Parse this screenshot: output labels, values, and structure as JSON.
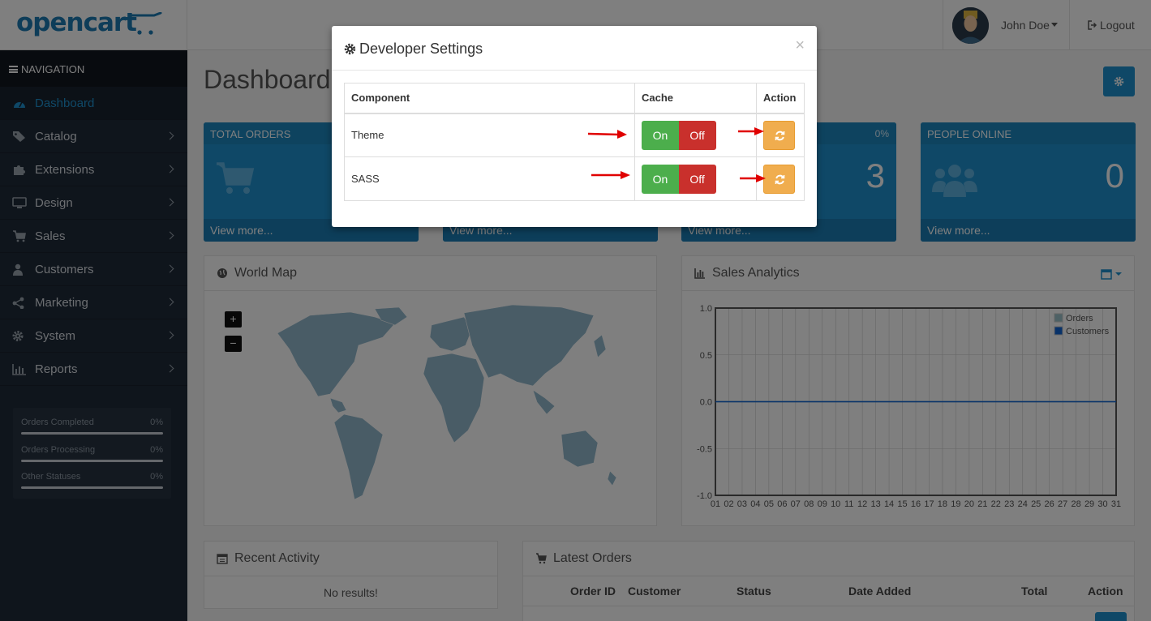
{
  "header": {
    "logo_text": "opencart",
    "user_name": "John Doe",
    "logout_label": "Logout"
  },
  "sidebar": {
    "nav_header": "NAVIGATION",
    "items": [
      {
        "label": "Dashboard",
        "icon": "dashboard-icon",
        "active": true
      },
      {
        "label": "Catalog",
        "icon": "tag-icon"
      },
      {
        "label": "Extensions",
        "icon": "puzzle-icon"
      },
      {
        "label": "Design",
        "icon": "monitor-icon"
      },
      {
        "label": "Sales",
        "icon": "cart-icon"
      },
      {
        "label": "Customers",
        "icon": "user-icon"
      },
      {
        "label": "Marketing",
        "icon": "share-icon"
      },
      {
        "label": "System",
        "icon": "gear-icon"
      },
      {
        "label": "Reports",
        "icon": "bar-chart-icon"
      }
    ],
    "progress": [
      {
        "label": "Orders Completed",
        "value": "0%"
      },
      {
        "label": "Orders Processing",
        "value": "0%"
      },
      {
        "label": "Other Statuses",
        "value": "0%"
      }
    ]
  },
  "main": {
    "title": "Dashboard",
    "tiles": [
      {
        "title": "TOTAL ORDERS",
        "pct": "",
        "value": "",
        "more": "View more..."
      },
      {
        "title": "",
        "pct": "",
        "value": "",
        "more": "View more..."
      },
      {
        "title": "",
        "pct": "0%",
        "value": "3",
        "more": "View more..."
      },
      {
        "title": "PEOPLE ONLINE",
        "pct": "",
        "value": "0",
        "more": "View more..."
      }
    ],
    "world_map": {
      "title": "World Map",
      "zoom_in": "+",
      "zoom_out": "−"
    },
    "sales_analytics": {
      "title": "Sales Analytics"
    },
    "recent_activity": {
      "title": "Recent Activity",
      "empty": "No results!"
    },
    "latest_orders": {
      "title": "Latest Orders",
      "columns": [
        "Order ID",
        "Customer",
        "Status",
        "Date Added",
        "Total",
        "Action"
      ]
    }
  },
  "chart_data": {
    "type": "line",
    "x": [
      "01",
      "02",
      "03",
      "04",
      "05",
      "06",
      "07",
      "08",
      "09",
      "10",
      "11",
      "12",
      "13",
      "14",
      "15",
      "16",
      "17",
      "18",
      "19",
      "20",
      "21",
      "22",
      "23",
      "24",
      "25",
      "26",
      "27",
      "28",
      "29",
      "30",
      "31"
    ],
    "series": [
      {
        "name": "Orders",
        "values": [
          0,
          0,
          0,
          0,
          0,
          0,
          0,
          0,
          0,
          0,
          0,
          0,
          0,
          0,
          0,
          0,
          0,
          0,
          0,
          0,
          0,
          0,
          0,
          0,
          0,
          0,
          0,
          0,
          0,
          0,
          0
        ],
        "color": "#9cc2cb"
      },
      {
        "name": "Customers",
        "values": [
          0,
          0,
          0,
          0,
          0,
          0,
          0,
          0,
          0,
          0,
          0,
          0,
          0,
          0,
          0,
          0,
          0,
          0,
          0,
          0,
          0,
          0,
          0,
          0,
          0,
          0,
          0,
          0,
          0,
          0,
          0
        ],
        "color": "#1065d2"
      }
    ],
    "yticks": [
      "1.0",
      "0.5",
      "0.0",
      "-0.5",
      "-1.0"
    ],
    "ylim": [
      -1,
      1
    ],
    "grid": true,
    "legend": "top-right"
  },
  "modal": {
    "title": "Developer Settings",
    "close": "×",
    "headers": {
      "component": "Component",
      "cache": "Cache",
      "action": "Action"
    },
    "rows": [
      {
        "component": "Theme",
        "on": "On",
        "off": "Off"
      },
      {
        "component": "SASS",
        "on": "On",
        "off": "Off"
      }
    ]
  },
  "colors": {
    "primary": "#1e91cf",
    "sidebar": "#1f2a39",
    "success": "#4cae4c",
    "danger": "#c9302c",
    "warning": "#f0ad4e",
    "arrow": "#e00000"
  }
}
